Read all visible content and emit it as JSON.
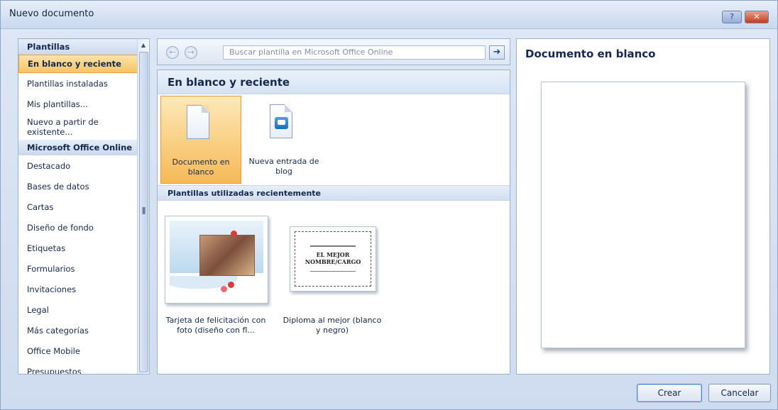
{
  "window": {
    "title": "Nuevo documento",
    "help_icon": "?",
    "close_icon": "✕"
  },
  "sidebar": {
    "scroll_up_icon": "▲",
    "groups": [
      {
        "header": "Plantillas",
        "items": [
          {
            "label": "En blanco y reciente",
            "selected": true
          },
          {
            "label": "Plantillas instaladas"
          },
          {
            "label": "Mis plantillas..."
          },
          {
            "label": "Nuevo a partir de existente..."
          }
        ]
      },
      {
        "header": "Microsoft Office Online",
        "items": [
          {
            "label": "Destacado"
          },
          {
            "label": "Bases de datos"
          },
          {
            "label": "Cartas"
          },
          {
            "label": "Diseño de fondo"
          },
          {
            "label": "Etiquetas"
          },
          {
            "label": "Formularios"
          },
          {
            "label": "Invitaciones"
          },
          {
            "label": "Legal"
          },
          {
            "label": "Más categorías"
          },
          {
            "label": "Office Mobile"
          },
          {
            "label": "Presupuestos"
          }
        ]
      }
    ]
  },
  "toolbar": {
    "back_icon": "←",
    "forward_icon": "→",
    "search_placeholder": "Buscar plantilla en Microsoft Office Online",
    "search_go_icon": "➜"
  },
  "main": {
    "section_title": "En blanco y reciente",
    "tiles": [
      {
        "label": "Documento en blanco",
        "icon": "blank-document-icon",
        "selected": true
      },
      {
        "label": "Nueva entrada de blog",
        "icon": "blog-post-icon"
      }
    ],
    "recent_header": "Plantillas utilizadas recientemente",
    "recent": [
      {
        "label": "Tarjeta de felicitación con foto (diseño con fl..."
      },
      {
        "label": "Diploma al mejor (blanco y negro)",
        "thumb_text": "EL MEJOR NOMBRE/CARGO"
      }
    ]
  },
  "preview": {
    "title": "Documento en blanco"
  },
  "footer": {
    "create_label": "Crear",
    "cancel_label": "Cancelar"
  },
  "colors": {
    "selection": "#f8c466",
    "accent": "#1c6cba",
    "header_bg": "#d5e2f3"
  }
}
